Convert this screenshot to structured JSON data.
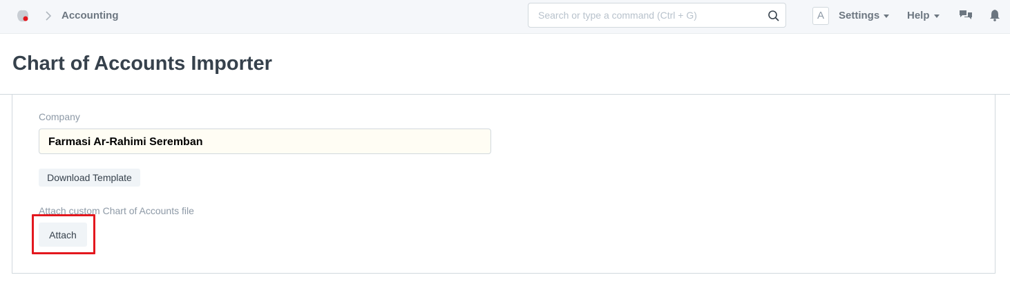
{
  "navbar": {
    "breadcrumb": "Accounting",
    "search_placeholder": "Search or type a command (Ctrl + G)",
    "avatar_initial": "A",
    "settings_label": "Settings",
    "help_label": "Help",
    "icons": [
      "app-logo-icon",
      "chevron-right-icon",
      "search-icon",
      "chat-icon",
      "bell-icon"
    ]
  },
  "page": {
    "title": "Chart of Accounts Importer"
  },
  "form": {
    "company_label": "Company",
    "company_value": "Farmasi Ar-Rahimi Seremban",
    "download_template_label": "Download Template",
    "attach_label": "Attach custom Chart of Accounts file",
    "attach_button_label": "Attach"
  },
  "colors": {
    "navbar_bg": "#f5f7fa",
    "field_bg": "#fffdf4",
    "button_bg": "#f0f4f7",
    "highlight": "#e3171e",
    "logo_red": "#e3171e"
  }
}
